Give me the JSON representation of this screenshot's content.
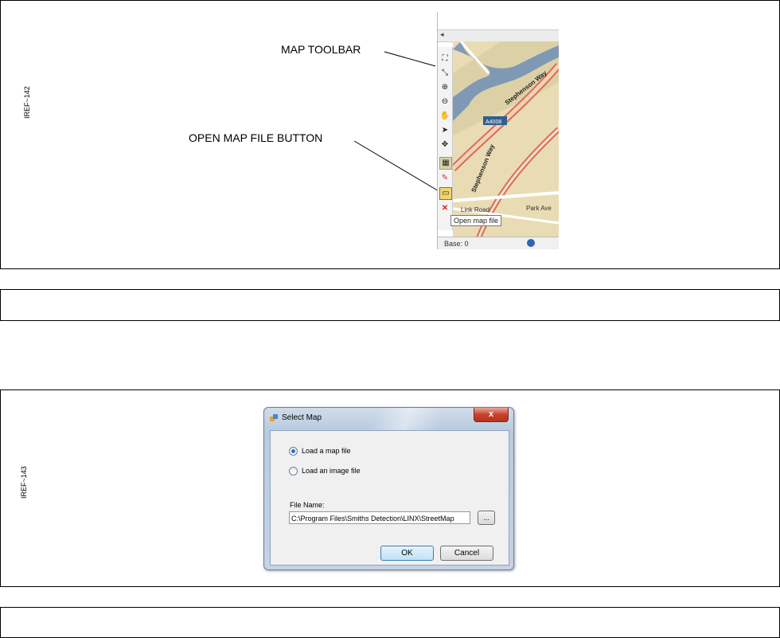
{
  "figure1": {
    "iref": "IREF~142",
    "callout_toolbar": "MAP TOOLBAR",
    "callout_open": "OPEN MAP FILE BUTTON",
    "tooltip": "Open map file",
    "map_labels": {
      "road_a": "Stephenson Way",
      "road_b": "Stephenson Way",
      "shield": "A4008",
      "link_road": "Link Road",
      "park": "Park Ave"
    },
    "status_label": "Base: 0"
  },
  "figure2": {
    "iref": "IREF~143",
    "dialog": {
      "title": "Select Map",
      "close": "x",
      "radio_map": "Load a map file",
      "radio_image": "Load an image file",
      "file_label": "File Name:",
      "file_value": "C:\\Program Files\\Smiths Detection\\LINX\\StreetMap",
      "browse": "...",
      "ok": "OK",
      "cancel": "Cancel"
    }
  }
}
